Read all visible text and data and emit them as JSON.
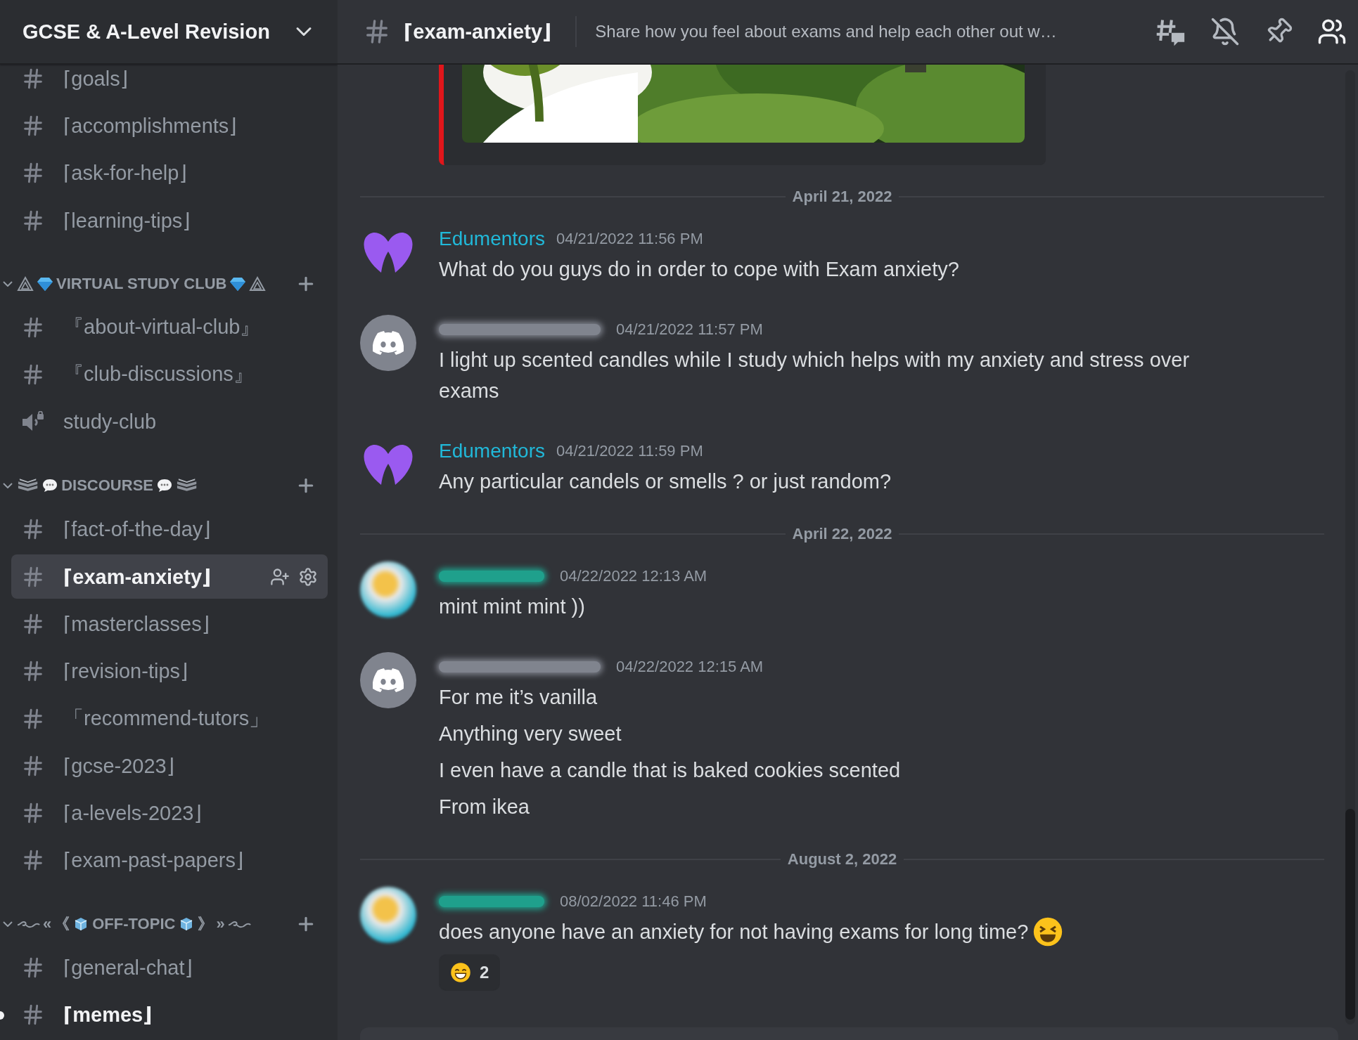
{
  "server": {
    "name": "GCSE & A-Level Revision"
  },
  "sidebar": {
    "items": [
      {
        "kind": "channel",
        "label": "⌈goals⌋",
        "selected": false,
        "unread": false
      },
      {
        "kind": "channel",
        "label": "⌈accomplishments⌋",
        "selected": false,
        "unread": false
      },
      {
        "kind": "channel",
        "label": "⌈ask-for-help⌋",
        "selected": false,
        "unread": false
      },
      {
        "kind": "channel",
        "label": "⌈learning-tips⌋",
        "selected": false,
        "unread": false
      },
      {
        "kind": "category",
        "expanded": true,
        "parts": [
          {
            "kind": "triangle"
          },
          {
            "kind": "gem"
          },
          {
            "kind": "text",
            "text": "VIRTUAL STUDY CLUB"
          },
          {
            "kind": "gem"
          },
          {
            "kind": "triangle"
          }
        ]
      },
      {
        "kind": "channel",
        "label": "『about-virtual-club』",
        "selected": false,
        "unread": false
      },
      {
        "kind": "channel",
        "label": "『club-discussions』",
        "selected": false,
        "unread": false
      },
      {
        "kind": "voice",
        "label": "study-club",
        "selected": false,
        "unread": false
      },
      {
        "kind": "category",
        "expanded": true,
        "parts": [
          {
            "kind": "books"
          },
          {
            "kind": "speech"
          },
          {
            "kind": "text",
            "text": "DISCOURSE"
          },
          {
            "kind": "speech"
          },
          {
            "kind": "books"
          }
        ]
      },
      {
        "kind": "channel",
        "label": "⌈fact-of-the-day⌋",
        "selected": false,
        "unread": false
      },
      {
        "kind": "channel",
        "label": "⌈exam-anxiety⌋",
        "selected": true,
        "unread": false
      },
      {
        "kind": "channel",
        "label": "⌈masterclasses⌋",
        "selected": false,
        "unread": false
      },
      {
        "kind": "channel",
        "label": "⌈revision-tips⌋",
        "selected": false,
        "unread": false
      },
      {
        "kind": "channel",
        "label": "「recommend-tutors」",
        "selected": false,
        "unread": false
      },
      {
        "kind": "channel",
        "label": "⌈gcse-2023⌋",
        "selected": false,
        "unread": false
      },
      {
        "kind": "channel",
        "label": "⌈a-levels-2023⌋",
        "selected": false,
        "unread": false
      },
      {
        "kind": "channel",
        "label": "⌈exam-past-papers⌋",
        "selected": false,
        "unread": false
      },
      {
        "kind": "category",
        "expanded": true,
        "parts": [
          {
            "kind": "swirl"
          },
          {
            "kind": "text",
            "text": "«"
          },
          {
            "kind": "text",
            "text": "《"
          },
          {
            "kind": "cube"
          },
          {
            "kind": "text",
            "text": "OFF-TOPIC"
          },
          {
            "kind": "cube"
          },
          {
            "kind": "text",
            "text": "》"
          },
          {
            "kind": "text",
            "text": "»"
          },
          {
            "kind": "swirl"
          }
        ]
      },
      {
        "kind": "channel",
        "label": "⌈general-chat⌋",
        "selected": false,
        "unread": false
      },
      {
        "kind": "channel",
        "label": "⌈memes⌋",
        "selected": false,
        "unread": true
      }
    ]
  },
  "header": {
    "channel": "⌈exam-anxiety⌋",
    "topic": "Share how you feel about exams and help each other out w…"
  },
  "messages": [
    {
      "kind": "embed",
      "color": "#e0161b"
    },
    {
      "kind": "divider",
      "date": "April 21, 2022"
    },
    {
      "kind": "message",
      "avatar": {
        "kind": "logo"
      },
      "author": "Edumentors",
      "color": "#21b8d8",
      "time": "04/21/2022 11:56 PM",
      "lines": [
        "What do you guys do in order to cope with Exam anxiety?"
      ]
    },
    {
      "kind": "message",
      "avatar": {
        "kind": "discord"
      },
      "color": "#80848e",
      "time": "04/21/2022 11:57 PM",
      "lines": [
        "I light up scented candles while I study which helps with my anxiety and stress over exams"
      ]
    },
    {
      "kind": "message",
      "avatar": {
        "kind": "logo"
      },
      "author": "Edumentors",
      "color": "#21b8d8",
      "time": "04/21/2022 11:59 PM",
      "lines": [
        "Any particular candels or smells ? or just random?"
      ]
    },
    {
      "kind": "divider",
      "date": "April 22, 2022"
    },
    {
      "kind": "message",
      "avatar": {
        "kind": "blurred"
      },
      "color": "#1fa08c",
      "time": "04/22/2022 12:13 AM",
      "lines": [
        "mint mint mint ))"
      ]
    },
    {
      "kind": "message",
      "avatar": {
        "kind": "discord"
      },
      "color": "#80848e",
      "time": "04/22/2022 12:15 AM",
      "lines": [
        "For me it’s vanilla",
        "Anything very sweet",
        "I even have a candle that is baked cookies scented",
        "From ikea"
      ]
    },
    {
      "kind": "divider",
      "date": "August 2, 2022"
    },
    {
      "kind": "message",
      "avatar": {
        "kind": "blurred"
      },
      "color": "#1fa08c",
      "time": "08/02/2022 11:46 PM",
      "lines": [
        "does anyone have an anxiety for not having exams for long time?"
      ],
      "trailing": {
        "kind": "laugh"
      },
      "reactions": [
        {
          "kind": "grin",
          "count": "2",
          "selected": false
        }
      ]
    }
  ]
}
